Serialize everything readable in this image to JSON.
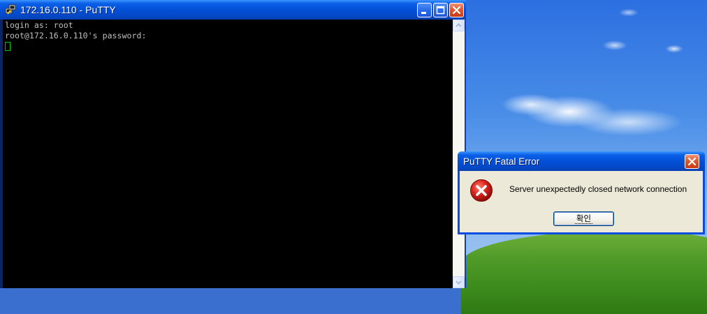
{
  "putty_window": {
    "title": "172.16.0.110 - PuTTY",
    "terminal_lines": [
      "login as: root",
      "root@172.16.0.110's password:"
    ]
  },
  "dialog": {
    "title": "PuTTY Fatal Error",
    "message": "Server unexpectedly closed network connection",
    "ok_label": "확인"
  },
  "colors": {
    "titlebar_blue": "#0351d8",
    "terminal_bg": "#000000",
    "terminal_text": "#bfbfbf",
    "cursor": "#00c800",
    "dialog_body": "#ece9d8",
    "error_red": "#d8201a"
  },
  "icons": {
    "putty_app": "putty-icon",
    "minimize": "minimize-icon",
    "maximize": "maximize-icon",
    "close": "close-icon",
    "error": "error-icon"
  }
}
